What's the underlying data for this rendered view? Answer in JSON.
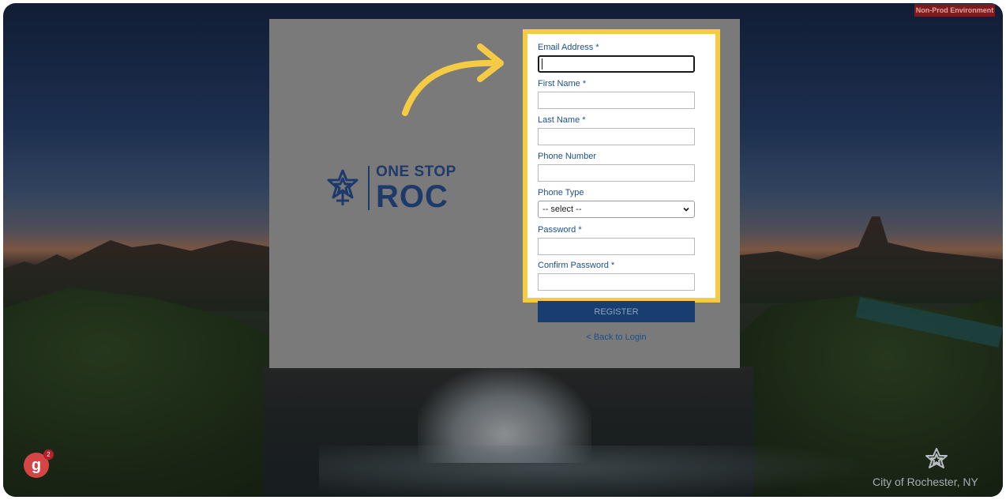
{
  "environment_badge": "Non-Prod Environment",
  "logo": {
    "line1": "ONE STOP",
    "line2": "ROC"
  },
  "form": {
    "email": {
      "label": "Email Address *",
      "value": ""
    },
    "first_name": {
      "label": "First Name *",
      "value": ""
    },
    "last_name": {
      "label": "Last Name *",
      "value": ""
    },
    "phone_number": {
      "label": "Phone Number",
      "value": ""
    },
    "phone_type": {
      "label": "Phone Type",
      "selected": "-- select --"
    },
    "password": {
      "label": "Password *",
      "value": ""
    },
    "confirm_password": {
      "label": "Confirm Password *",
      "value": ""
    },
    "register_label": "REGISTER",
    "back_link": "< Back to Login"
  },
  "corner_badge": {
    "letter": "g",
    "count": "2"
  },
  "footer_caption": "City of Rochester, NY",
  "colors": {
    "highlight": "#f5ca45",
    "primary": "#173e6e",
    "label": "#1f4e8a",
    "env_badge": "#7c1d1d"
  },
  "icons": [
    "rochester-flower-logo-icon",
    "curved-arrow-icon",
    "chevron-down-icon",
    "rochester-flower-watermark-icon"
  ]
}
